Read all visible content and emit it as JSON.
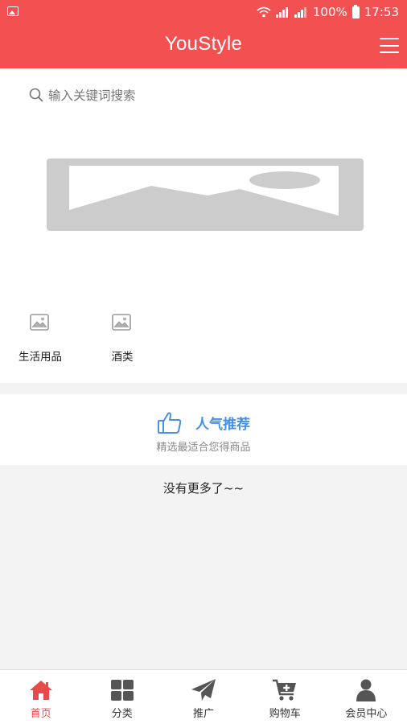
{
  "status_bar": {
    "battery": "100%",
    "time": "17:53"
  },
  "header": {
    "title": "YouStyle"
  },
  "search": {
    "placeholder": "输入关键词搜索"
  },
  "categories": [
    {
      "label": "生活用品",
      "icon": "image-placeholder-icon"
    },
    {
      "label": "酒类",
      "icon": "image-placeholder-icon"
    }
  ],
  "recommend": {
    "title": "人气推荐",
    "subtitle": "精选最适合您得商品",
    "icon": "thumbs-up-icon"
  },
  "list_end": {
    "text": "没有更多了~~"
  },
  "tabbar": {
    "items": [
      {
        "label": "首页",
        "icon": "home-icon",
        "active": true
      },
      {
        "label": "分类",
        "icon": "grid-icon",
        "active": false
      },
      {
        "label": "推广",
        "icon": "paper-plane-icon",
        "active": false
      },
      {
        "label": "购物车",
        "icon": "cart-icon",
        "active": false
      },
      {
        "label": "会员中心",
        "icon": "user-icon",
        "active": false
      }
    ]
  },
  "colors": {
    "primary": "#f25051",
    "accent_blue": "#4a90e2",
    "active_tab": "#e84a4a",
    "page_bg": "#f3f3f3"
  }
}
